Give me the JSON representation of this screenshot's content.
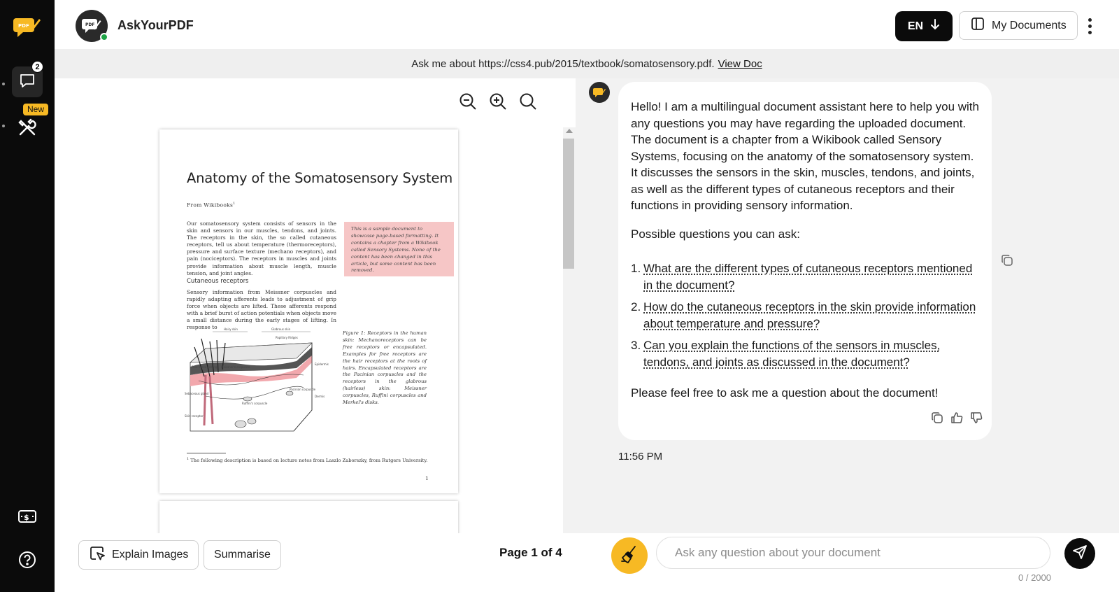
{
  "app": {
    "name": "AskYourPDF",
    "online": true
  },
  "sidebar": {
    "chat_badge": "2",
    "new_badge": "New",
    "items": [
      {
        "name": "chat",
        "icon": "chat-bubble-icon"
      },
      {
        "name": "tools",
        "icon": "tools-icon"
      },
      {
        "name": "pricing",
        "icon": "money-icon"
      },
      {
        "name": "help",
        "icon": "help-icon"
      }
    ]
  },
  "header": {
    "language": "EN",
    "my_documents_label": "My Documents"
  },
  "doc_bar": {
    "prefix": "Ask me about https://css4.pub/2015/textbook/somatosensory.pdf.",
    "view_doc_label": "View Doc"
  },
  "pdf_page": {
    "title": "Anatomy of the Somatosensory System",
    "from": "From Wikibooks",
    "from_sup": "1",
    "paragraph1": "Our somatosensory system consists of sensors in the skin and sensors in our muscles, tendons, and joints. The receptors in the skin, the so called cutaneous receptors, tell us about temperature (thermoreceptors), pressure and surface texture (mechano receptors), and pain (nociceptors). The receptors in muscles and joints provide information about muscle length, muscle tension, and joint angles.",
    "subheading": "Cutaneous receptors",
    "paragraph2": "Sensory information from Meissner corpuscles and rapidly adapting afferents leads to adjustment of grip force when objects are lifted. These afferents respond with a brief burst of action potentials when objects move a small distance during the early stages of lifting. In response to",
    "note": "This is a sample document to showcase page-based formatting. It contains a chapter from a Wikibook called Sensory Systems. None of the content has been changed in this article, but some content has been removed.",
    "caption": "Figure 1: Receptors in the human skin: Mechanoreceptors can be free receptors or encapsulated. Examples for free receptors are the hair receptors at the roots of hairs. Encapsulated receptors are the Pacinian corpuscles and the receptors in the glabrous (hairless) skin: Meissner corpuscles, Ruffini corpuscles and Merkel's disks.",
    "figure_labels": {
      "hairy_skin": "Hairy skin",
      "glabrous_skin": "Glabrous skin",
      "papillary_ridges": "Papillary Ridges",
      "epidermis": "Epidermis",
      "dermis": "Dermis",
      "skin_receptor": "Skin receptor",
      "pacinian": "Pacinian corpuscle",
      "ruffini": "Ruffini's corpuscle",
      "meissner": "Meissner's corpuscle",
      "sebaceous": "Sebaceous gland",
      "free_nerve": "Free nerve ending"
    },
    "footnote_mark": "1",
    "footnote": "The following description is based on lecture notes from Laszlo Zaborszky, from Rutgers University.",
    "page_number": "1"
  },
  "chat": {
    "intro": "Hello! I am a multilingual document assistant here to help you with any questions you may have regarding the uploaded document. The document is a chapter from a Wikibook called Sensory Systems, focusing on the anatomy of the somatosensory system. It discusses the sensors in the skin, muscles, tendons, and joints, as well as the different types of cutaneous receptors and their functions in providing sensory information.",
    "questions_heading": "Possible questions you can ask:",
    "questions": [
      {
        "n": "1.",
        "text": "What are the different types of cutaneous receptors mentioned in the document?"
      },
      {
        "n": "2.",
        "text": "How do the cutaneous receptors in the skin provide information about temperature and pressure?"
      },
      {
        "n": "3.",
        "text": "Can you explain the functions of the sensors in muscles, tendons, and joints as discussed in the document?"
      }
    ],
    "outro": "Please feel free to ask me a question about the document!",
    "timestamp": "11:56 PM"
  },
  "footer": {
    "explain_images_label": "Explain Images",
    "summarise_label": "Summarise",
    "page_indicator": "Page 1 of 4",
    "input_placeholder": "Ask any question about your document",
    "input_value": "",
    "char_count": "0 / 2000"
  },
  "colors": {
    "accent": "#f7b924",
    "rail": "#0b0b0b",
    "online": "#1ea446",
    "note_bg": "#f6c6c6"
  }
}
